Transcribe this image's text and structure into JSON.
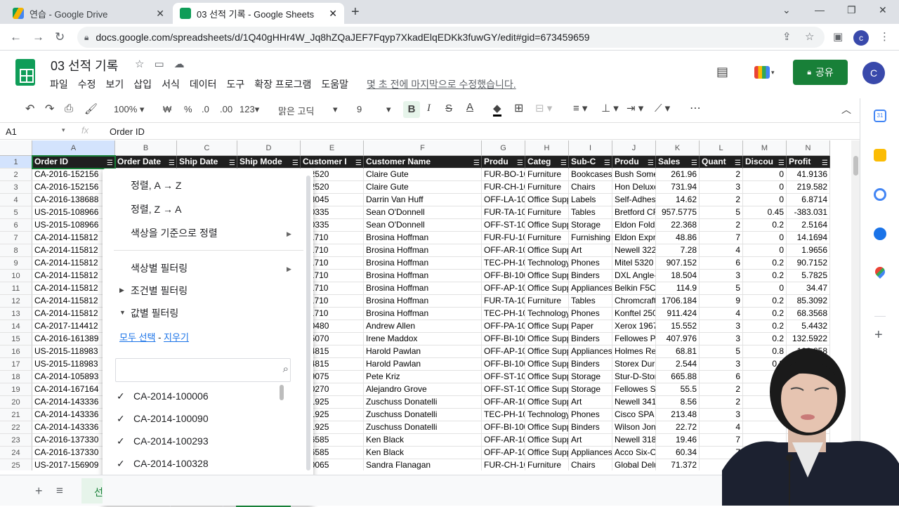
{
  "browser": {
    "tabs": [
      {
        "title": "연습 - Google Drive",
        "active": false
      },
      {
        "title": "03 선적 기록 - Google Sheets",
        "active": true
      }
    ],
    "url": "docs.google.com/spreadsheets/d/1Q40gHHr4W_Jq8hZQaJEF7Fqyp7XkadElqEDKk3fuwGY/edit#gid=673459659",
    "profile_initial": "c"
  },
  "app": {
    "doc_title": "03 선적 기록",
    "menus": [
      "파일",
      "수정",
      "보기",
      "삽입",
      "서식",
      "데이터",
      "도구",
      "확장 프로그램",
      "도움말"
    ],
    "last_edit": "몇 초 전에 마지막으로 수정했습니다.",
    "share_label": "공유",
    "avatar_initial": "C",
    "accent": "#188038"
  },
  "toolbar": {
    "zoom": "100%",
    "currency": "₩",
    "percent": "%",
    "dec_less": ".0",
    "dec_more": ".00",
    "format": "123",
    "font": "맑은 고딕",
    "font_size": "9"
  },
  "formula_bar": {
    "cell_ref": "A1",
    "value": "Order ID"
  },
  "grid": {
    "columns": [
      "A",
      "B",
      "C",
      "D",
      "E",
      "F",
      "G",
      "H",
      "I",
      "J",
      "K",
      "L",
      "M",
      "N"
    ],
    "header_row": [
      "Order ID",
      "Order Date",
      "Ship Date",
      "Ship Mode",
      "Customer I",
      "Customer Name",
      "Produ",
      "Categ",
      "Sub-C",
      "Produ",
      "Sales",
      "Quant",
      "Discou",
      "Profit"
    ],
    "rows": [
      {
        "n": "2",
        "a": "CA-2016-152156",
        "e": "-12520",
        "f": "Claire Gute",
        "g": "FUR-BO-10",
        "h": "Furniture",
        "i": "Bookcases",
        "j": "Bush Some",
        "k": "261.96",
        "l": "2",
        "m": "0",
        "n2": "41.9136"
      },
      {
        "n": "3",
        "a": "CA-2016-152156",
        "e": "-12520",
        "f": "Claire Gute",
        "g": "FUR-CH-10",
        "h": "Furniture",
        "i": "Chairs",
        "j": "Hon Deluxe",
        "k": "731.94",
        "l": "3",
        "m": "0",
        "n2": "219.582"
      },
      {
        "n": "4",
        "a": "CA-2016-138688",
        "e": "-13045",
        "f": "Darrin Van Huff",
        "g": "OFF-LA-100",
        "h": "Office Supp",
        "i": "Labels",
        "j": "Self-Adhes",
        "k": "14.62",
        "l": "2",
        "m": "0",
        "n2": "6.8714"
      },
      {
        "n": "5",
        "a": "US-2015-108966",
        "e": "-20335",
        "f": "Sean O'Donnell",
        "g": "FUR-TA-10",
        "h": "Furniture",
        "i": "Tables",
        "j": "Bretford CF",
        "k": "957.5775",
        "l": "5",
        "m": "0.45",
        "n2": "-383.031"
      },
      {
        "n": "6",
        "a": "US-2015-108966",
        "e": "-20335",
        "f": "Sean O'Donnell",
        "g": "OFF-ST-100",
        "h": "Office Supp",
        "i": "Storage",
        "j": "Eldon Fold",
        "k": "22.368",
        "l": "2",
        "m": "0.2",
        "n2": "2.5164"
      },
      {
        "n": "7",
        "a": "CA-2014-115812",
        "e": "-11710",
        "f": "Brosina Hoffman",
        "g": "FUR-FU-10",
        "h": "Furniture",
        "i": "Furnishing",
        "j": "Eldon Expr",
        "k": "48.86",
        "l": "7",
        "m": "0",
        "n2": "14.1694"
      },
      {
        "n": "8",
        "a": "CA-2014-115812",
        "e": "-11710",
        "f": "Brosina Hoffman",
        "g": "OFF-AR-10",
        "h": "Office Supp",
        "i": "Art",
        "j": "Newell 322",
        "k": "7.28",
        "l": "4",
        "m": "0",
        "n2": "1.9656"
      },
      {
        "n": "9",
        "a": "CA-2014-115812",
        "e": "-11710",
        "f": "Brosina Hoffman",
        "g": "TEC-PH-10",
        "h": "Technology",
        "i": "Phones",
        "j": "Mitel 5320",
        "k": "907.152",
        "l": "6",
        "m": "0.2",
        "n2": "90.7152"
      },
      {
        "n": "10",
        "a": "CA-2014-115812",
        "e": "-11710",
        "f": "Brosina Hoffman",
        "g": "OFF-BI-100",
        "h": "Office Supp",
        "i": "Binders",
        "j": "DXL Angle-",
        "k": "18.504",
        "l": "3",
        "m": "0.2",
        "n2": "5.7825"
      },
      {
        "n": "11",
        "a": "CA-2014-115812",
        "e": "-11710",
        "f": "Brosina Hoffman",
        "g": "OFF-AP-10",
        "h": "Office Supp",
        "i": "Appliances",
        "j": "Belkin F5C",
        "k": "114.9",
        "l": "5",
        "m": "0",
        "n2": "34.47"
      },
      {
        "n": "12",
        "a": "CA-2014-115812",
        "e": "-11710",
        "f": "Brosina Hoffman",
        "g": "FUR-TA-10",
        "h": "Furniture",
        "i": "Tables",
        "j": "Chromcraft",
        "k": "1706.184",
        "l": "9",
        "m": "0.2",
        "n2": "85.3092"
      },
      {
        "n": "13",
        "a": "CA-2014-115812",
        "e": "-11710",
        "f": "Brosina Hoffman",
        "g": "TEC-PH-10",
        "h": "Technology",
        "i": "Phones",
        "j": "Konftel 250",
        "k": "911.424",
        "l": "4",
        "m": "0.2",
        "n2": "68.3568"
      },
      {
        "n": "14",
        "a": "CA-2017-114412",
        "e": "-10480",
        "f": "Andrew Allen",
        "g": "OFF-PA-10",
        "h": "Office Supp",
        "i": "Paper",
        "j": "Xerox 1967",
        "k": "15.552",
        "l": "3",
        "m": "0.2",
        "n2": "5.4432"
      },
      {
        "n": "15",
        "a": "CA-2016-161389",
        "e": "-15070",
        "f": "Irene Maddox",
        "g": "OFF-BI-100",
        "h": "Office Supp",
        "i": "Binders",
        "j": "Fellowes P",
        "k": "407.976",
        "l": "3",
        "m": "0.2",
        "n2": "132.5922"
      },
      {
        "n": "16",
        "a": "US-2015-118983",
        "e": "-14815",
        "f": "Harold Pawlan",
        "g": "OFF-AP-10",
        "h": "Office Supp",
        "i": "Appliances",
        "j": "Holmes Re",
        "k": "68.81",
        "l": "5",
        "m": "0.8",
        "n2": "-123.858"
      },
      {
        "n": "17",
        "a": "US-2015-118983",
        "e": "-14815",
        "f": "Harold Pawlan",
        "g": "OFF-BI-100",
        "h": "Office Supp",
        "i": "Binders",
        "j": "Storex Dur",
        "k": "2.544",
        "l": "3",
        "m": "0.8",
        "n2": ""
      },
      {
        "n": "18",
        "a": "CA-2014-105893",
        "e": "-19075",
        "f": "Pete Kriz",
        "g": "OFF-ST-100",
        "h": "Office Supp",
        "i": "Storage",
        "j": "Stur-D-Stor",
        "k": "665.88",
        "l": "6",
        "m": "0",
        "n2": ""
      },
      {
        "n": "19",
        "a": "CA-2014-167164",
        "e": "-10270",
        "f": "Alejandro Grove",
        "g": "OFF-ST-100",
        "h": "Office Supp",
        "i": "Storage",
        "j": "Fellowes S",
        "k": "55.5",
        "l": "2",
        "m": "0",
        "n2": ""
      },
      {
        "n": "20",
        "a": "CA-2014-143336",
        "e": "-21925",
        "f": "Zuschuss Donatelli",
        "g": "OFF-AR-10",
        "h": "Office Supp",
        "i": "Art",
        "j": "Newell 341",
        "k": "8.56",
        "l": "2",
        "m": "",
        "n2": ""
      },
      {
        "n": "21",
        "a": "CA-2014-143336",
        "e": "-21925",
        "f": "Zuschuss Donatelli",
        "g": "TEC-PH-10",
        "h": "Technology",
        "i": "Phones",
        "j": "Cisco SPA 5",
        "k": "213.48",
        "l": "3",
        "m": "0.",
        "n2": ""
      },
      {
        "n": "22",
        "a": "CA-2014-143336",
        "e": "-21925",
        "f": "Zuschuss Donatelli",
        "g": "OFF-BI-100",
        "h": "Office Supp",
        "i": "Binders",
        "j": "Wilson Jon",
        "k": "22.72",
        "l": "4",
        "m": "",
        "n2": ""
      },
      {
        "n": "23",
        "a": "CA-2016-137330",
        "e": "-16585",
        "f": "Ken Black",
        "g": "OFF-AR-10",
        "h": "Office Supp",
        "i": "Art",
        "j": "Newell 318",
        "k": "19.46",
        "l": "7",
        "m": "",
        "n2": ""
      },
      {
        "n": "24",
        "a": "CA-2016-137330",
        "e": "-16585",
        "f": "Ken Black",
        "g": "OFF-AP-10",
        "h": "Office Supp",
        "i": "Appliances",
        "j": "Acco Six-O",
        "k": "60.34",
        "l": "7",
        "m": "",
        "n2": ""
      },
      {
        "n": "25",
        "a": "US-2017-156909",
        "e": "-20065",
        "f": "Sandra Flanagan",
        "g": "FUR-CH-10",
        "h": "Furniture",
        "i": "Chairs",
        "j": "Global Delu",
        "k": "71.372",
        "l": "",
        "m": "",
        "n2": ""
      }
    ]
  },
  "filter_menu": {
    "sort_az": "정렬, A → Z",
    "sort_za": "정렬, Z → A",
    "sort_color": "색상을 기준으로 정렬",
    "filter_color": "색상별 필터링",
    "filter_condition": "조건별 필터링",
    "filter_value": "값별 필터링",
    "select_all": "모두 선택",
    "dash": "-",
    "clear": "지우기",
    "values": [
      "CA-2014-100006",
      "CA-2014-100090",
      "CA-2014-100293",
      "CA-2014-100328"
    ]
  },
  "sheet_tabs": {
    "first_tab_partial": "선"
  }
}
